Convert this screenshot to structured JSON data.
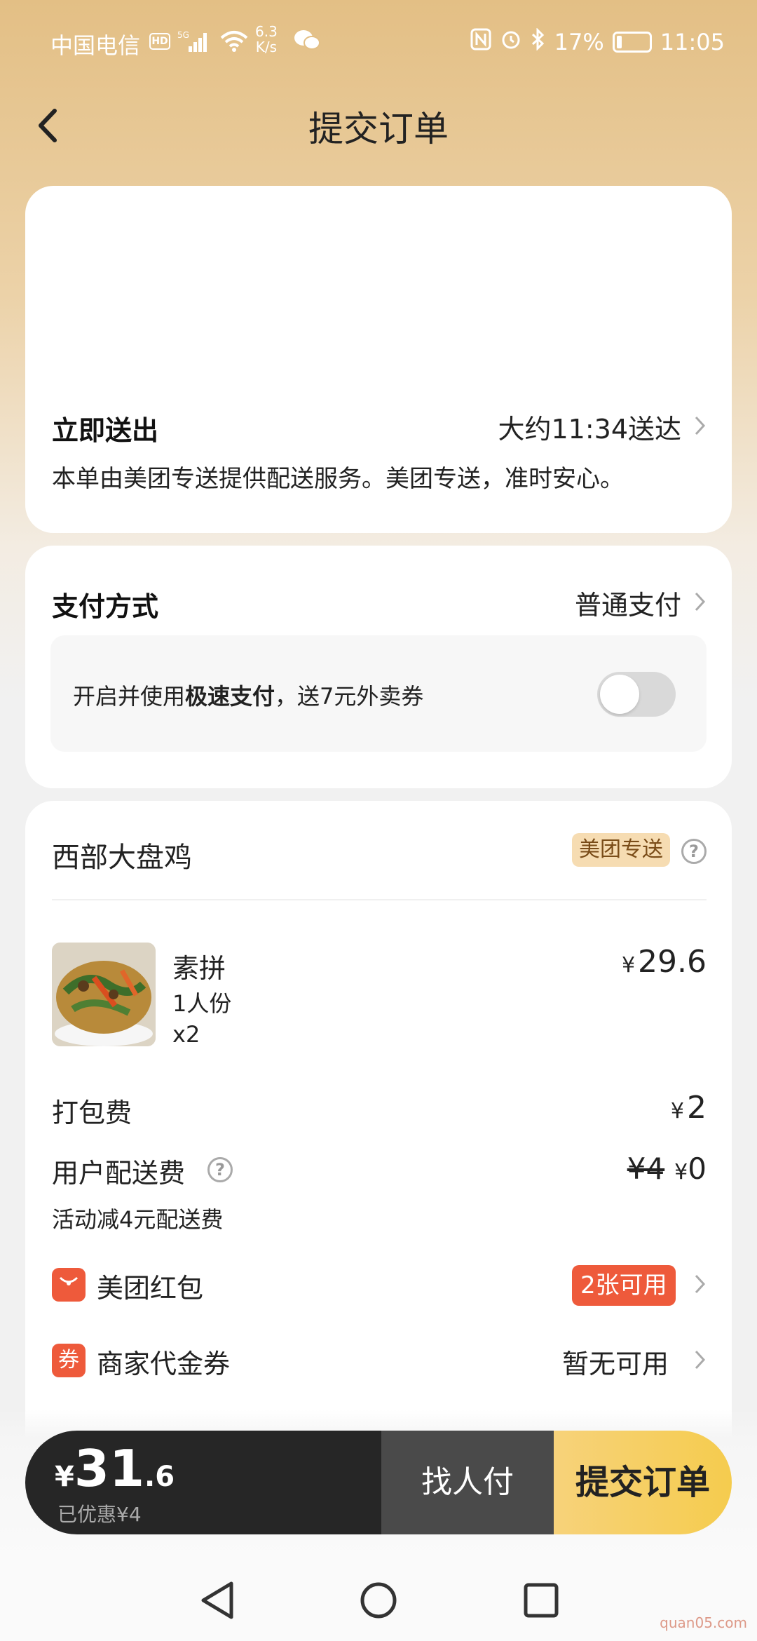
{
  "status_bar": {
    "carrier": "中国电信",
    "hd": "HD",
    "signal_label": "5G",
    "net_speed_value": "6.3",
    "net_speed_unit": "K/s",
    "battery": "17%",
    "battery_level": 0.17,
    "time": "11:05"
  },
  "header": {
    "title": "提交订单"
  },
  "delivery": {
    "label": "立即送出",
    "eta": "大约11:34送达",
    "note": "本单由美团专送提供配送服务。美团专送，准时安心。"
  },
  "payment": {
    "label": "支付方式",
    "method": "普通支付",
    "promo_prefix": "开启并使用",
    "promo_bold": "极速支付",
    "promo_suffix": "，送7元外卖券",
    "toggle_on": false
  },
  "store": {
    "name": "西部大盘鸡",
    "tag": "美团专送",
    "item": {
      "name": "素拼",
      "spec": "1人份",
      "qty": "x2",
      "price": "29.6",
      "currency": "¥"
    },
    "packing_fee": {
      "label": "打包费",
      "value": "2",
      "currency": "¥"
    },
    "delivery_fee": {
      "label": "用户配送费",
      "original": "¥4",
      "final": "0",
      "currency": "¥",
      "note": "活动减4元配送费"
    },
    "red_packet": {
      "label": "美团红包",
      "icon_text": "",
      "badge": "2张可用"
    },
    "voucher": {
      "label": "商家代金券",
      "icon_text": "券",
      "value": "暂无可用"
    }
  },
  "bottom_bar": {
    "currency": "¥",
    "total_int": "31",
    "total_dec": ".6",
    "discount": "已优惠¥4",
    "friend_pay": "找人付",
    "submit": "提交订单"
  },
  "watermark": "quan05.com",
  "colors": {
    "accent_red": "#ee5a3b",
    "submit_yellow": "#f5cc4e",
    "header_gold": "#e3bf85",
    "tag_bg": "#f6dcb2"
  }
}
